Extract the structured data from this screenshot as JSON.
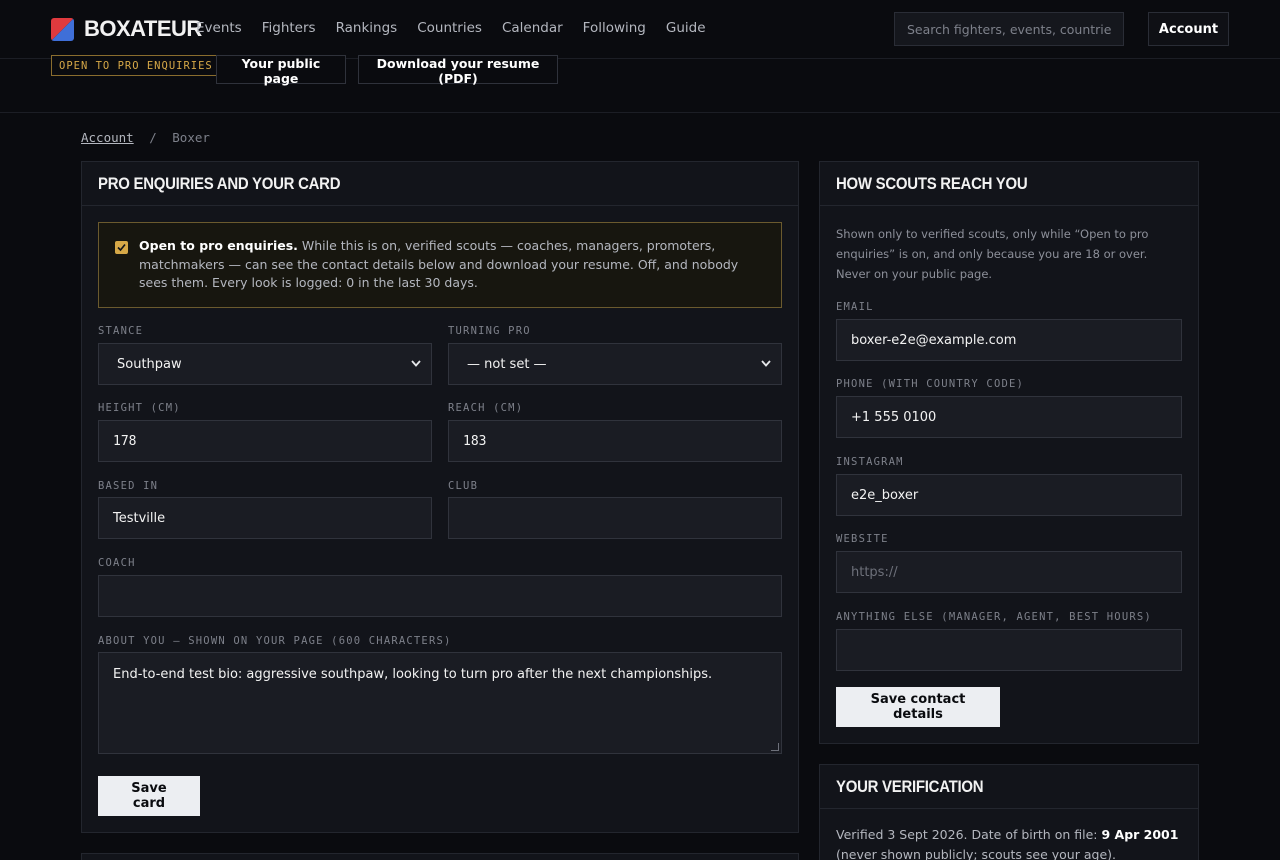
{
  "brand": {
    "name": "BOXATEUR",
    "colors": {
      "red": "#e03a3e",
      "blue": "#3f6fd8"
    }
  },
  "nav": {
    "links": [
      "Events",
      "Fighters",
      "Rankings",
      "Countries",
      "Calendar",
      "Following",
      "Guide"
    ],
    "search_placeholder": "Search fighters, events, countries",
    "account_label": "Account"
  },
  "subbar": {
    "badge": "OPEN TO PRO ENQUIRIES",
    "public_page": "Your public page",
    "resume": "Download your resume (PDF)"
  },
  "breadcrumb": {
    "parent": "Account",
    "separator": "/",
    "current": "Boxer"
  },
  "card_panel": {
    "title": "Pro enquiries and your card",
    "notice": {
      "lead": "Open to pro enquiries.",
      "body": " While this is on, verified scouts — coaches, managers, promoters, matchmakers — can see the contact details below and download your resume. Off, and nobody sees them. Every look is logged: 0 in the last 30 days."
    },
    "stance": {
      "label": "Stance",
      "value": "Southpaw"
    },
    "turning_pro": {
      "label": "Turning pro",
      "value": "— not set —"
    },
    "height": {
      "label": "Height (cm)",
      "value": "178"
    },
    "reach": {
      "label": "Reach (cm)",
      "value": "183"
    },
    "based_in": {
      "label": "Based in",
      "value": "Testville"
    },
    "club": {
      "label": "Club",
      "value": ""
    },
    "coach": {
      "label": "Coach",
      "value": ""
    },
    "about": {
      "label": "About you — shown on your page (600 characters)",
      "value": "End-to-end test bio: aggressive southpaw, looking to turn pro after the next championships."
    },
    "save_label": "Save card"
  },
  "contact_panel": {
    "title": "How scouts reach you",
    "intro": "Shown only to verified scouts, only while “Open to pro enquiries” is on, and only because you are 18 or over. Never on your public page.",
    "email": {
      "label": "Email",
      "value": "boxer-e2e@example.com"
    },
    "phone": {
      "label": "Phone (with country code)",
      "value": "+1 555 0100"
    },
    "instagram": {
      "label": "Instagram",
      "value": "e2e_boxer"
    },
    "website": {
      "label": "Website",
      "placeholder": "https://"
    },
    "other": {
      "label": "Anything else (manager, agent, best hours)",
      "value": ""
    },
    "save_label": "Save contact details"
  },
  "verification_panel": {
    "title": "Your verification",
    "text_a": "Verified 3 Sept 2026. Date of birth on file: ",
    "dob": "9 Apr 2001",
    "text_b": " (never shown publicly; scouts see your age)."
  }
}
